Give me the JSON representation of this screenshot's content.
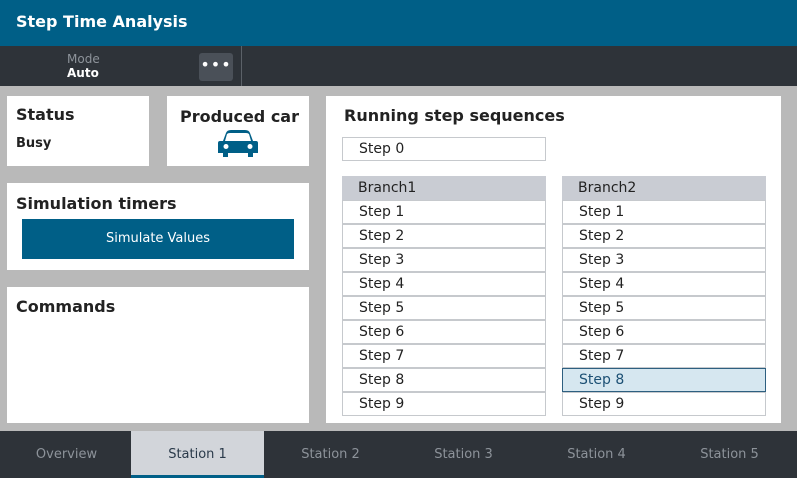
{
  "header": {
    "title": "Step Time Analysis"
  },
  "modebar": {
    "mode_label": "Mode",
    "mode_value": "Auto",
    "more_label": "•••"
  },
  "status": {
    "title": "Status",
    "value": "Busy"
  },
  "produced": {
    "title": "Produced car",
    "icon": "car-icon"
  },
  "timers": {
    "title": "Simulation timers",
    "button_label": "Simulate Values"
  },
  "commands": {
    "title": "Commands"
  },
  "sequences": {
    "title": "Running step sequences",
    "step0": "Step 0",
    "branch1": {
      "header": "Branch1",
      "steps": [
        "Step 1",
        "Step 2",
        "Step 3",
        "Step 4",
        "Step 5",
        "Step 6",
        "Step 7",
        "Step 8",
        "Step 9"
      ]
    },
    "branch2": {
      "header": "Branch2",
      "steps": [
        "Step 1",
        "Step 2",
        "Step 3",
        "Step 4",
        "Step 5",
        "Step 6",
        "Step 7",
        "Step 8",
        "Step 9"
      ],
      "selected": "Step 8"
    }
  },
  "tabs": [
    {
      "label": "Overview"
    },
    {
      "label": "Station 1"
    },
    {
      "label": "Station 2"
    },
    {
      "label": "Station 3"
    },
    {
      "label": "Station 4"
    },
    {
      "label": "Station 5"
    }
  ],
  "active_tab": "Station 1",
  "colors": {
    "brand": "#005f87",
    "bar": "#2e3339",
    "selected_fill": "#d6e7f0"
  }
}
